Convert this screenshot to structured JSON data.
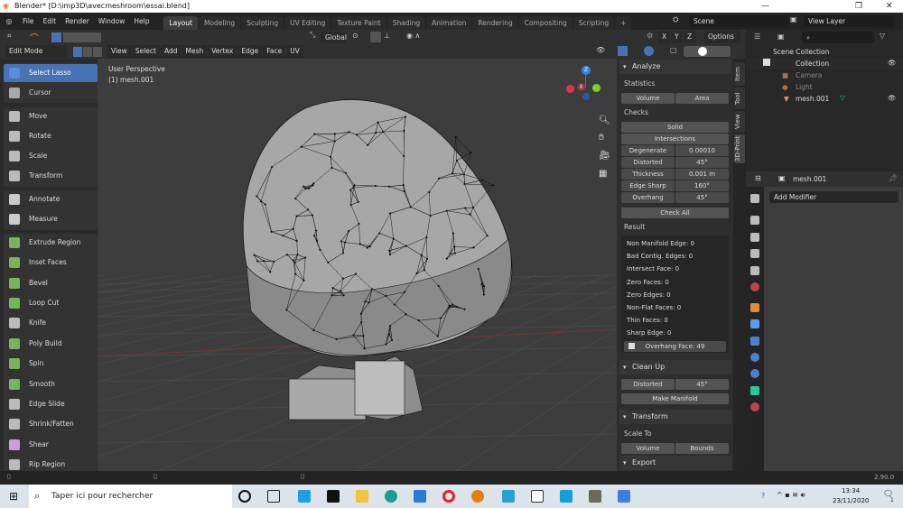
{
  "window": {
    "title": "Blender* [D:\\imp3D\\avecmeshroom\\essai.blend]",
    "minimize": "—",
    "maximize": "❐",
    "close": "✕"
  },
  "menus": [
    "File",
    "Edit",
    "Render",
    "Window",
    "Help"
  ],
  "workspaces": [
    "Layout",
    "Modeling",
    "Sculpting",
    "UV Editing",
    "Texture Paint",
    "Shading",
    "Animation",
    "Rendering",
    "Compositing",
    "Scripting",
    "+"
  ],
  "active_workspace": "Layout",
  "scene": "Scene",
  "view_layer": "View Layer",
  "tool_header": {
    "orientation": "Global",
    "axes": [
      "X",
      "Y",
      "Z"
    ],
    "options": "Options"
  },
  "edit_header": {
    "mode": "Edit Mode",
    "menus": [
      "View",
      "Select",
      "Add",
      "Mesh",
      "Vertex",
      "Edge",
      "Face",
      "UV"
    ]
  },
  "tools": [
    "Select Lasso",
    "Cursor",
    "Move",
    "Rotate",
    "Scale",
    "Transform",
    "Annotate",
    "Measure",
    "Extrude Region",
    "Inset Faces",
    "Bevel",
    "Loop Cut",
    "Knife",
    "Poly Build",
    "Spin",
    "Smooth",
    "Edge Slide",
    "Shrink/Fatten",
    "Shear",
    "Rip Region"
  ],
  "active_tool": "Select Lasso",
  "viewport": {
    "perspective": "User Perspective",
    "object": "(1) mesh.001",
    "gizmo": {
      "z": "Z",
      "x": "X"
    }
  },
  "npanel": {
    "tabs": [
      "Item",
      "Tool",
      "View",
      "3D-Print"
    ],
    "active_tab": "3D-Print",
    "analyze": {
      "title": "Analyze",
      "statistics": "Statistics",
      "volume": "Volume",
      "area": "Area",
      "checks": "Checks",
      "solid": "Solid",
      "intersections": "Intersections",
      "params": [
        {
          "label": "Degenerate",
          "value": "0.00010"
        },
        {
          "label": "Distorted",
          "value": "45°"
        },
        {
          "label": "Thickness",
          "value": "0.001 m"
        },
        {
          "label": "Edge Sharp",
          "value": "160°"
        },
        {
          "label": "Overhang",
          "value": "45°"
        }
      ],
      "check_all": "Check All",
      "result": "Result",
      "results": [
        "Non Manifold Edge: 0",
        "Bad Contig. Edges: 0",
        "Intersect Face: 0",
        "Zero Faces: 0",
        "Zero Edges: 0",
        "Non-Flat Faces: 0",
        "Thin Faces: 0",
        "Sharp Edge: 0"
      ],
      "overhang_result": "Overhang Face: 49"
    },
    "cleanup": {
      "title": "Clean Up",
      "distorted": "Distorted",
      "distorted_value": "45°",
      "make_manifold": "Make Manifold"
    },
    "transform": {
      "title": "Transform",
      "scale_to": "Scale To",
      "volume": "Volume",
      "bounds": "Bounds"
    },
    "export": {
      "title": "Export"
    }
  },
  "outliner": {
    "scene_collection": "Scene Collection",
    "collection": "Collection",
    "items": [
      "Camera",
      "Light",
      "mesh.001"
    ]
  },
  "properties": {
    "object": "mesh.001",
    "add_modifier": "Add Modifier"
  },
  "status": {
    "version": "2.90.0"
  },
  "taskbar": {
    "search_placeholder": "Taper ici pour rechercher",
    "time": "13:34",
    "date": "23/11/2020",
    "notifications": "1"
  }
}
